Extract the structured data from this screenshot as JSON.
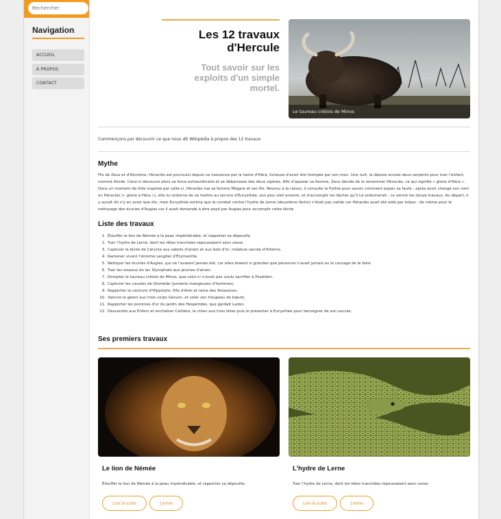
{
  "search": {
    "placeholder": "Rechercher"
  },
  "nav": {
    "title": "Navigation",
    "items": [
      {
        "label": "Accueil"
      },
      {
        "label": "À propos"
      },
      {
        "label": "Contact"
      }
    ]
  },
  "hero": {
    "title_line1": "Les 12 travaux",
    "title_line2": "d'Hercule",
    "subtitle_line1": "Tout savoir sur les",
    "subtitle_line2": "exploits d'un simple",
    "subtitle_line3": "mortel.",
    "image_caption": "Le taureau crétois de Minos",
    "image_icon": "highland-bull-photo"
  },
  "intro": "Commençons par découvrir ce que nous dit Wikipédia à propos des 12 travaux",
  "mythe": {
    "heading": "Mythe",
    "text": "Fils de Zeus et d'Alcmène, Héraclès est poursuivi depuis sa naissance par la haine d'Héra, furieuse d'avoir été trompée par son mari. Une nuit, la déesse envoie deux serpents pour tuer l'enfant, nommé Alcide. Celui-ci découvre alors sa force extraordinaire et se débarrasse des deux vipères. Afin d'apaiser sa femme, Zeus décide de le renommer Héraclès, ce qui signifie « gloire d'Héra ». Dans un moment de folie inspirée par celle-ci, Héraclès tue sa femme Mégare et ses fils. Revenu à la raison, il consulte la Pythie pour savoir comment expier sa faute : après avoir changé son nom en Héraclès (« gloire à Héra »), elle lui ordonne de se mettre au service d'Eurysthée, son plus vieil ennemi, et d'accomplir les tâches qu'il lui ordonnerait : ce seront les douze travaux. Au départ, il y aurait dû n'y en avoir que dix, mais Eurysthée estima que le combat contre l'hydre de Lerne (deuxième tâche) n'était pas valide car Héraclès avait été aidé par Iolaos ; de même pour le nettoyage des écuries d'Augias car il avait demandé à être payé par Augias pour accomplir cette tâche."
  },
  "labours": {
    "heading": "Liste des travaux",
    "items": [
      {
        "num": "1.",
        "text": "Étouffer le lion de Némée à la peau impénétrable, et rapporter sa dépouille."
      },
      {
        "num": "2.",
        "text": "Tuer l'hydre de Lerne, dont les têtes tranchées repoussaient sans cesse."
      },
      {
        "num": "3.",
        "text": "Capturer la biche de Cérynie aux sabots d'airain et aux bois d'or, créature sacrée d'Artémis."
      },
      {
        "num": "4.",
        "text": "Ramener vivant l'énorme sanglier d'Érymanthe."
      },
      {
        "num": "5.",
        "text": "Nettoyer les écuries d'Augias, qui ne l'avaient jamais été, car elles étaient si grandes que personne n'avait jamais eu le courage de le faire."
      },
      {
        "num": "6.",
        "text": "Tuer les oiseaux du lac Stymphale aux plumes d'airain."
      },
      {
        "num": "7.",
        "text": "Dompter le taureau crétois de Minos, que celui-ci n'avait pas voulu sacrifier à Poséidon."
      },
      {
        "num": "8.",
        "text": "Capturer les cavales de Diomède (juments mangeuses d'hommes)."
      },
      {
        "num": "9.",
        "text": "Rapporter la ceinture d'Hippolyte, fille d'Arès et reine des Amazones."
      },
      {
        "num": "10.",
        "text": "Vaincre le géant aux trois corps Géryon, et voler son troupeau de bœufs."
      },
      {
        "num": "11.",
        "text": "Rapporter les pommes d'or du jardin des Hespérides, que gardait Ladon."
      },
      {
        "num": "12.",
        "text": "Descendre aux Enfers et enchaîner Cerbère, le chien aux trois têtes puis le présenter à Eurysthée pour témoigner de son succès."
      }
    ]
  },
  "premiers": {
    "heading": "Ses premiers travaux",
    "cards": [
      {
        "title": "Le lion de Némée",
        "text": "Étouffer le lion de Némée à la peau impénétrable, et rapporter sa dépouille.",
        "read_more": "Lire la suite",
        "like": "J'aime",
        "image_icon": "lion-photo"
      },
      {
        "title": "L'hydre de Lerne",
        "text": "Tuer l'hydre de Lerne, dont les têtes tranchées repoussaient sans cesse.",
        "read_more": "Lire la suite",
        "like": "J'aime",
        "image_icon": "snake-photo"
      }
    ]
  },
  "colors": {
    "accent": "#f39a1e",
    "subtitle": "#a8a8a8"
  }
}
